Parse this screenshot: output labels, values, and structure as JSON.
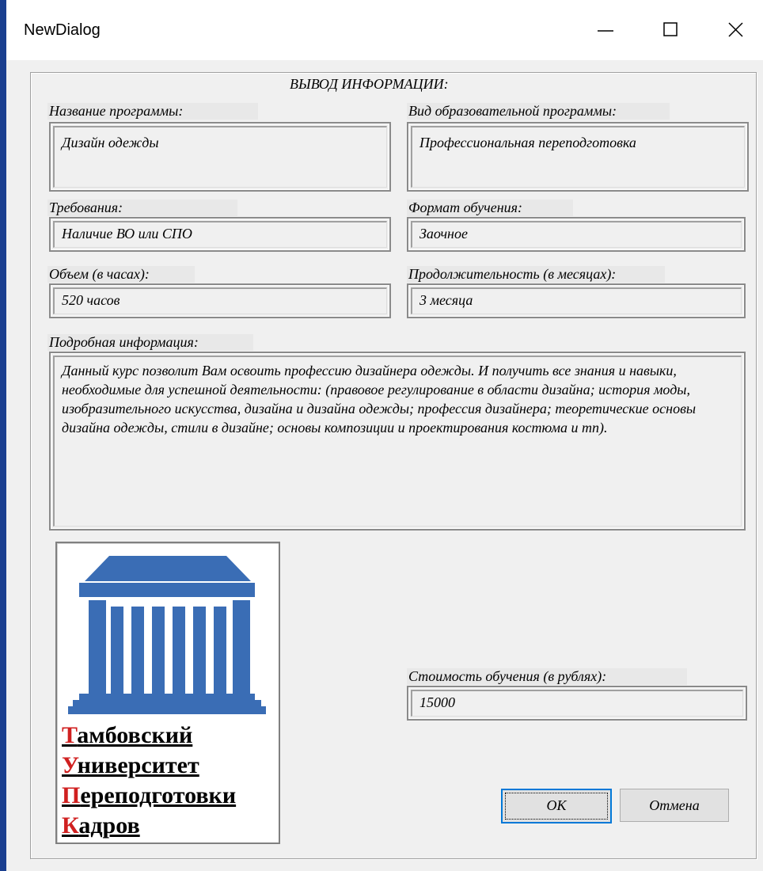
{
  "window": {
    "title": "NewDialog",
    "controls": [
      "minimize-icon",
      "maximize-icon",
      "close-icon"
    ]
  },
  "group": {
    "title": "ВЫВОД ИНФОРМАЦИИ:"
  },
  "fields": {
    "program_name": {
      "label": "Название программы:",
      "value": "Дизайн одежды"
    },
    "program_type": {
      "label": "Вид образовательной программы:",
      "value": "Профессиональная переподготовка"
    },
    "requirements": {
      "label": "Требования:",
      "value": "Наличие ВО или СПО"
    },
    "format": {
      "label": "Формат обучения:",
      "value": "Заочное"
    },
    "volume": {
      "label": "Объем (в часах):",
      "value": "520 часов"
    },
    "duration": {
      "label": "Продолжительность (в месяцах):",
      "value": "3 месяца"
    },
    "details": {
      "label": "Подробная информация:",
      "value": "Данный курс позволит Вам освоить профессию дизайнера одежды. И получить все знания и навыки, необходимые для успешной деятельности: (правовое регулирование в области дизайна; история моды, изобразительного искусства, дизайна и дизайна одежды; профессия дизайнера; теоретические основы дизайна одежды, стили в дизайне; основы композиции и проектирования костюма и тп)."
    },
    "cost": {
      "label": "Стоимость обучения (в рублях):",
      "value": "15000"
    }
  },
  "logo": {
    "icon": "university-building-icon",
    "lines": [
      {
        "first": "Т",
        "rest": "амбовский"
      },
      {
        "first": "У",
        "rest": "ниверситет"
      },
      {
        "first": "П",
        "rest": "ереподготовки"
      },
      {
        "first": "К",
        "rest": "адров"
      }
    ],
    "colors": {
      "building": "#3a6db5",
      "initial": "#d02020"
    }
  },
  "buttons": {
    "ok": "ОК",
    "cancel": "Отмена"
  },
  "colors": {
    "desktop": "#1a3f8f",
    "dialog_bg": "#f0f0f0",
    "focus_border": "#0078d7"
  }
}
